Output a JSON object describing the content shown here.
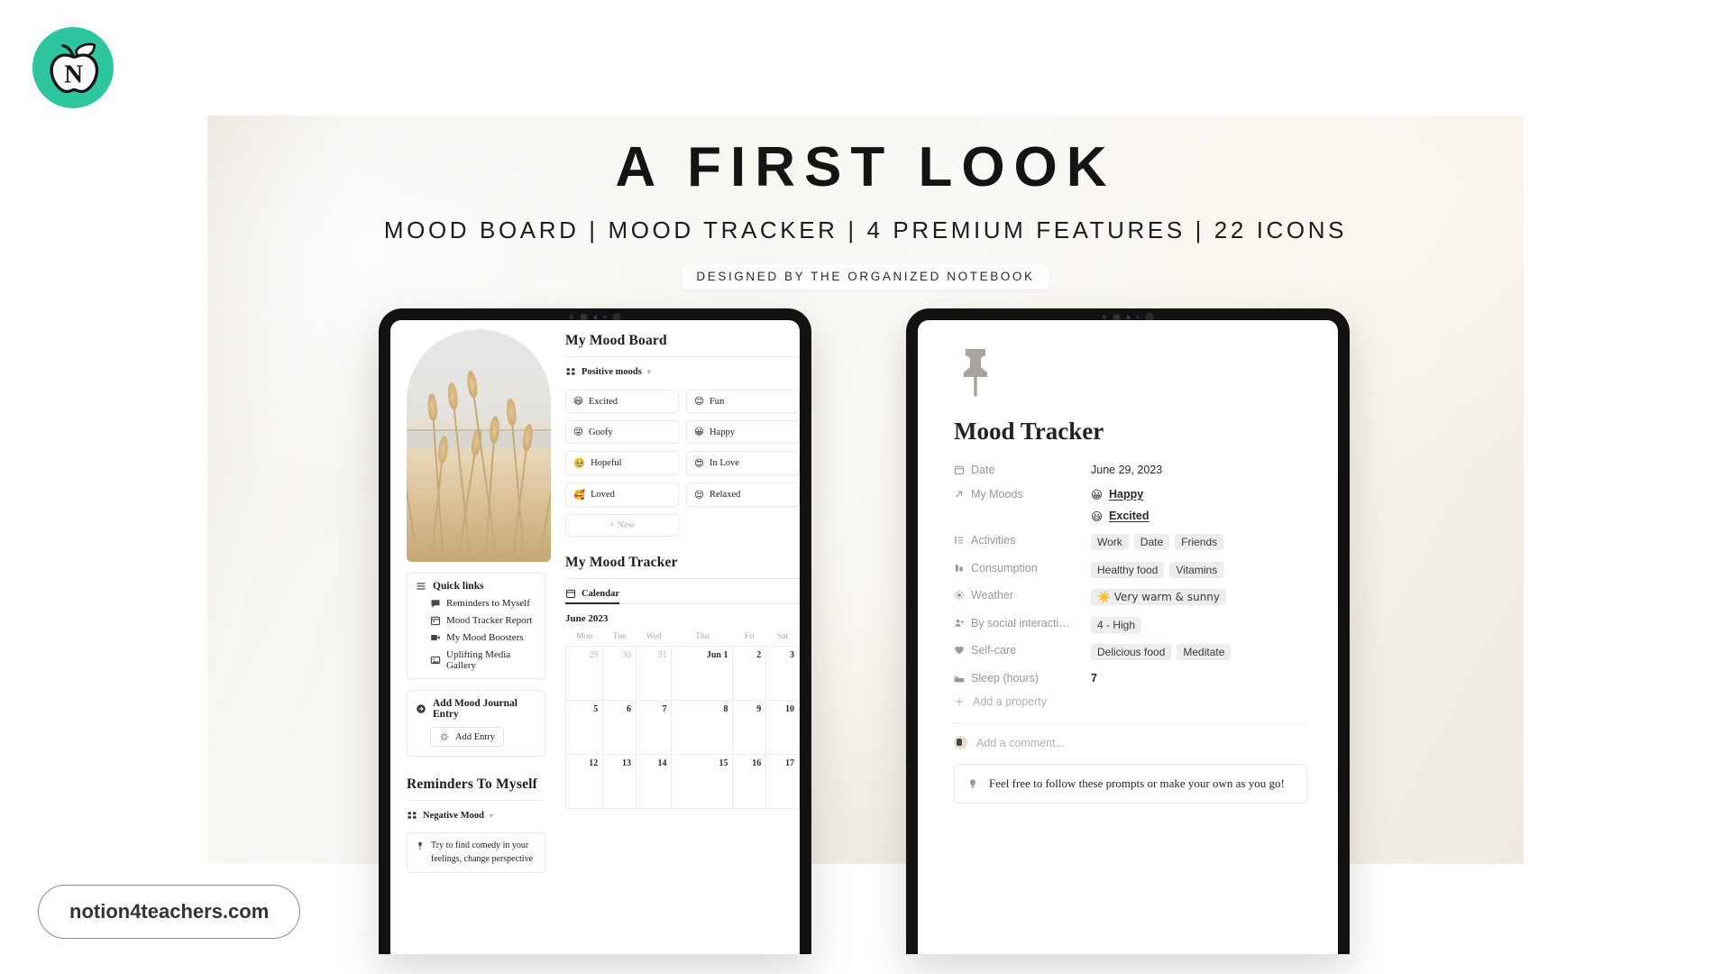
{
  "brand": {
    "logo_letter": "N",
    "logo_color": "#2ec6a0",
    "url_pill": "notion4teachers.com"
  },
  "hero": {
    "title": "A FIRST LOOK",
    "subtitle": "MOOD BOARD | MOOD TRACKER | 4 PREMIUM FEATURES | 22 ICONS",
    "badge": "DESIGNED BY THE ORGANIZED NOTEBOOK"
  },
  "left_tablet": {
    "quick_links": {
      "heading": "Quick links",
      "heading_icon": "menu-icon",
      "items": [
        {
          "label": "Reminders to Myself",
          "icon": "speech-bubble-icon"
        },
        {
          "label": "Mood Tracker Report",
          "icon": "calendar-icon"
        },
        {
          "label": "My Mood Boosters",
          "icon": "video-icon"
        },
        {
          "label": "Uplifting Media Gallery",
          "icon": "image-icon"
        }
      ]
    },
    "journal": {
      "heading": "Add Mood Journal Entry",
      "heading_icon": "arrow-circle-icon",
      "button": "Add Entry",
      "button_icon": "sparkle-icon"
    },
    "reminders": {
      "heading": "Reminders To Myself",
      "view_name": "Negative Mood",
      "view_icon": "gallery-view-icon",
      "cards": [
        {
          "icon": "pin-icon",
          "text": "Try to find comedy in your feelings, change perspective"
        }
      ]
    },
    "mood_board": {
      "heading": "My Mood Board",
      "view_name": "Positive moods",
      "view_icon": "gallery-view-icon",
      "moods": [
        {
          "label": "Excited",
          "emoji": "😃"
        },
        {
          "label": "Fun",
          "emoji": "😊"
        },
        {
          "label": "Goofy",
          "emoji": "😜"
        },
        {
          "label": "Happy",
          "emoji": "😀"
        },
        {
          "label": "Hopeful",
          "emoji": "🥹"
        },
        {
          "label": "In Love",
          "emoji": "😍"
        },
        {
          "label": "Loved",
          "emoji": "🥰"
        },
        {
          "label": "Relaxed",
          "emoji": "😌"
        }
      ],
      "new_button": "New"
    },
    "mood_tracker": {
      "heading": "My Mood Tracker",
      "tab": "Calendar",
      "tab_icon": "calendar-icon",
      "month": "June 2023",
      "weekdays": [
        "Mon",
        "Tue",
        "Wed",
        "Thu",
        "Fri",
        "Sat"
      ],
      "weeks": [
        [
          {
            "label": "29",
            "current": false
          },
          {
            "label": "30",
            "current": false
          },
          {
            "label": "31",
            "current": false
          },
          {
            "label": "Jun 1",
            "current": true
          },
          {
            "label": "2",
            "current": true
          },
          {
            "label": "3",
            "current": true
          }
        ],
        [
          {
            "label": "5",
            "current": true
          },
          {
            "label": "6",
            "current": true
          },
          {
            "label": "7",
            "current": true
          },
          {
            "label": "8",
            "current": true
          },
          {
            "label": "9",
            "current": true
          },
          {
            "label": "10",
            "current": true
          }
        ],
        [
          {
            "label": "12",
            "current": true
          },
          {
            "label": "13",
            "current": true
          },
          {
            "label": "14",
            "current": true
          },
          {
            "label": "15",
            "current": true
          },
          {
            "label": "16",
            "current": true
          },
          {
            "label": "17",
            "current": true
          }
        ]
      ]
    }
  },
  "right_tablet": {
    "page_icon": "pushpin-icon",
    "title": "Mood Tracker",
    "properties": [
      {
        "icon": "calendar-icon",
        "label": "Date",
        "type": "text",
        "values": [
          "June 29, 2023"
        ]
      },
      {
        "icon": "relation-arrow-icon",
        "label": "My Moods",
        "type": "moods",
        "moods": [
          {
            "emoji": "😀",
            "label": "Happy"
          },
          {
            "emoji": "😃",
            "label": "Excited"
          }
        ]
      },
      {
        "icon": "multiselect-icon",
        "label": "Activities",
        "type": "tags",
        "values": [
          "Work",
          "Date",
          "Friends"
        ]
      },
      {
        "icon": "bottle-icon",
        "label": "Consumption",
        "type": "tags",
        "values": [
          "Healthy food",
          "Vitamins"
        ]
      },
      {
        "icon": "sun-icon",
        "label": "Weather",
        "type": "tags",
        "values": [
          "☀️ Very warm & sunny"
        ]
      },
      {
        "icon": "person-plus-icon",
        "label": "By social interacti…",
        "type": "tags",
        "values": [
          "4 - High"
        ]
      },
      {
        "icon": "heart-icon",
        "label": "Self-care",
        "type": "tags",
        "values": [
          "Delicious food",
          "Meditate"
        ]
      },
      {
        "icon": "bed-icon",
        "label": "Sleep (hours)",
        "type": "text",
        "values": [
          "7"
        ]
      }
    ],
    "add_property": "Add a property",
    "comment_placeholder": "Add a comment...",
    "callout": {
      "icon": "lightbulb-icon",
      "text": "Feel free to follow these prompts or make your own as you go!"
    }
  }
}
